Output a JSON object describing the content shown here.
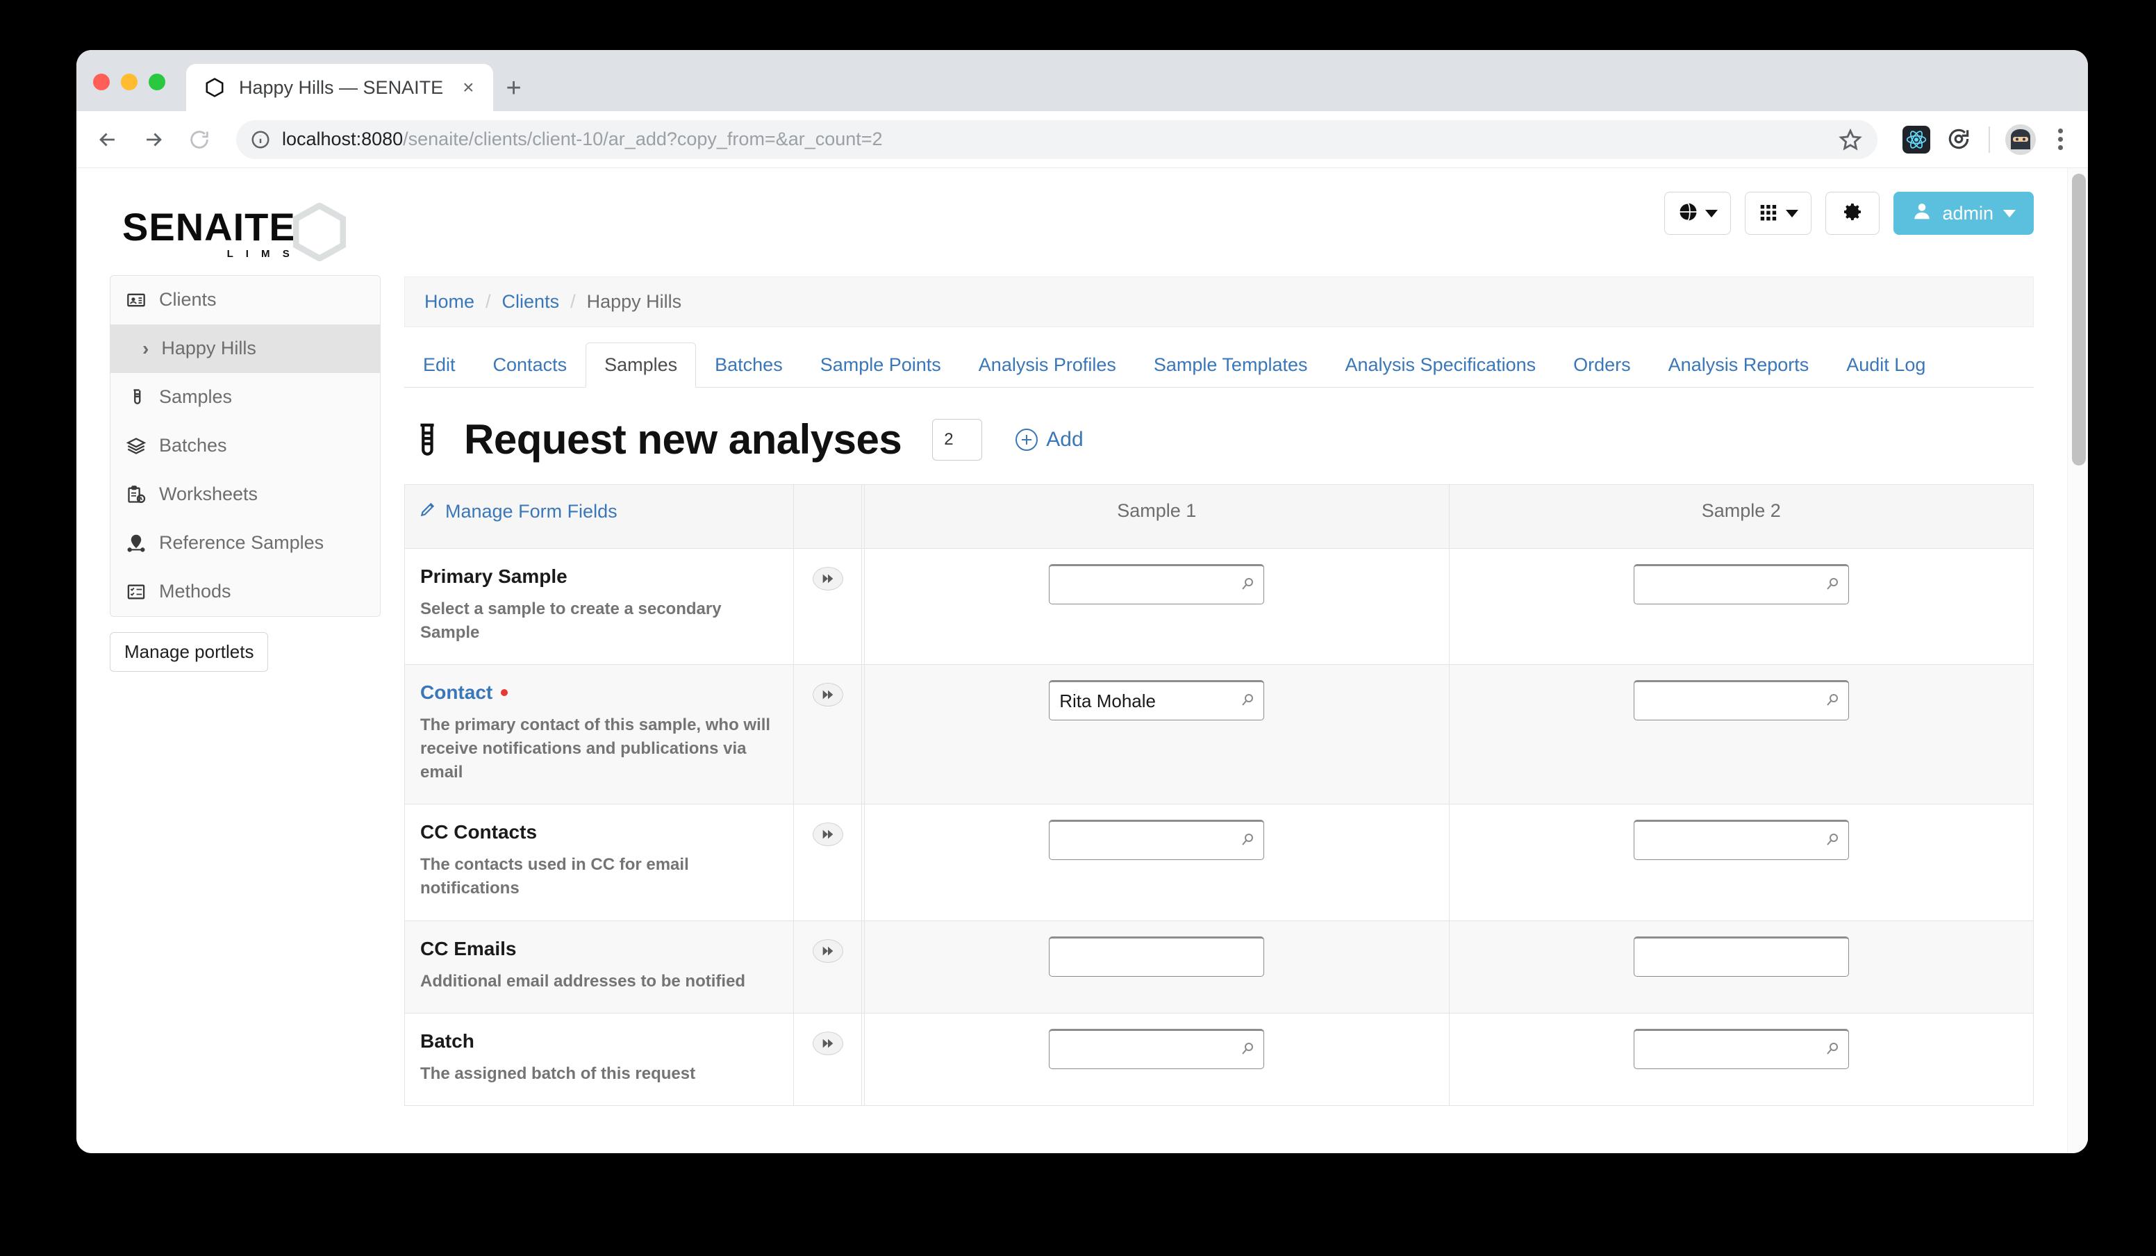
{
  "browser": {
    "tab": {
      "title": "Happy Hills — SENAITE",
      "favicon": "hexagon-icon",
      "close": "×"
    },
    "new_tab_label": "+",
    "url_host": "localhost:8080",
    "url_path": "/senaite/clients/client-10/ar_add?copy_from=&ar_count=2",
    "back_icon": "back-arrow-icon",
    "forward_icon": "forward-arrow-icon",
    "reload_icon": "reload-icon",
    "info_icon": "info-circle-icon",
    "star_icon": "bookmark-star-icon",
    "extensions": [
      "react-devtools-icon",
      "sync-refresh-icon"
    ],
    "profile_icon": "ninja-avatar-icon",
    "menu_icon": "kebab-menu-icon"
  },
  "header": {
    "logo_main": "SENAITE",
    "logo_sub": "L I M S",
    "actions": {
      "language_icon": "globe-icon",
      "apps_icon": "grid-apps-icon",
      "settings_icon": "gear-icon",
      "user_icon": "user-icon",
      "user_label": "admin"
    }
  },
  "sidebar": {
    "items": [
      {
        "label": "Clients",
        "icon": "id-card-icon",
        "active": false,
        "sub": false
      },
      {
        "label": "Happy Hills",
        "icon": "chevron-right-icon",
        "active": true,
        "sub": true
      },
      {
        "label": "Samples",
        "icon": "test-tube-icon",
        "active": false,
        "sub": false
      },
      {
        "label": "Batches",
        "icon": "layers-icon",
        "active": false,
        "sub": false
      },
      {
        "label": "Worksheets",
        "icon": "clipboard-clock-icon",
        "active": false,
        "sub": false
      },
      {
        "label": "Reference Samples",
        "icon": "map-pin-icon",
        "active": false,
        "sub": false
      },
      {
        "label": "Methods",
        "icon": "checklist-icon",
        "active": false,
        "sub": false
      }
    ],
    "manage_portlets": "Manage portlets"
  },
  "breadcrumb": {
    "home": "Home",
    "clients": "Clients",
    "current": "Happy Hills",
    "separator": "/"
  },
  "tabs": [
    {
      "label": "Edit",
      "active": false
    },
    {
      "label": "Contacts",
      "active": false
    },
    {
      "label": "Samples",
      "active": true
    },
    {
      "label": "Batches",
      "active": false
    },
    {
      "label": "Sample Points",
      "active": false
    },
    {
      "label": "Analysis Profiles",
      "active": false
    },
    {
      "label": "Sample Templates",
      "active": false
    },
    {
      "label": "Analysis Specifications",
      "active": false
    },
    {
      "label": "Orders",
      "active": false
    },
    {
      "label": "Analysis Reports",
      "active": false
    },
    {
      "label": "Audit Log",
      "active": false
    }
  ],
  "page": {
    "title": "Request new analyses",
    "title_icon": "test-tube-icon",
    "count_value": "2",
    "add_label": "Add",
    "add_icon": "plus-circle-icon"
  },
  "form": {
    "manage_fields_label": "Manage Form Fields",
    "manage_fields_icon": "pencil-icon",
    "columns": [
      "Sample 1",
      "Sample 2"
    ],
    "copy_icon": "double-chevron-right-icon",
    "search_icon": "magnifier-icon",
    "rows": [
      {
        "name": "Primary Sample",
        "description": "Select a sample to create a secondary Sample",
        "is_link": false,
        "required": false,
        "searchable": true,
        "values": [
          "",
          ""
        ]
      },
      {
        "name": "Contact",
        "description": "The primary contact of this sample, who will receive notifications and publications via email",
        "is_link": true,
        "required": true,
        "searchable": true,
        "values": [
          "Rita Mohale",
          ""
        ]
      },
      {
        "name": "CC Contacts",
        "description": "The contacts used in CC for email notifications",
        "is_link": false,
        "required": false,
        "searchable": true,
        "values": [
          "",
          ""
        ]
      },
      {
        "name": "CC Emails",
        "description": "Additional email addresses to be notified",
        "is_link": false,
        "required": false,
        "searchable": false,
        "values": [
          "",
          ""
        ]
      },
      {
        "name": "Batch",
        "description": "The assigned batch of this request",
        "is_link": false,
        "required": false,
        "searchable": true,
        "values": [
          "",
          ""
        ]
      }
    ]
  },
  "colors": {
    "accent": "#3a77b8",
    "admin_button": "#5bc0de",
    "required": "#e53935"
  }
}
